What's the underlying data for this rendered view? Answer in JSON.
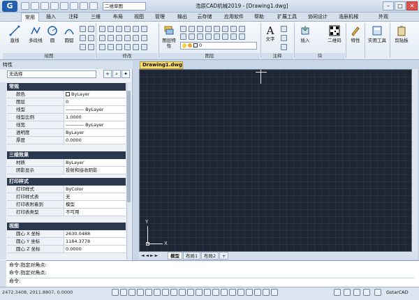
{
  "app": {
    "logo": "G",
    "title": "浩辰CAD机械2019 - [Drawing1.dwg]",
    "workspace": "二维草图"
  },
  "tabs": [
    "常用",
    "插入",
    "注释",
    "三维",
    "布局",
    "视图",
    "管理",
    "输出",
    "云存储",
    "应用软件",
    "帮助",
    "扩展工具",
    "协同设计",
    "浩辰机械",
    "外观"
  ],
  "ribbon": {
    "draw": {
      "buttons": [
        "直线",
        "多段线",
        "圆",
        "圆弧"
      ],
      "label": "绘图"
    },
    "modify": {
      "label": "修改"
    },
    "layer": {
      "props_label": "图层特性",
      "current": "0",
      "label": "图层"
    },
    "annotate": {
      "text": "文字",
      "label": "注释"
    },
    "block": {
      "insert": "插入",
      "qr": "二维码",
      "label": "块"
    },
    "properties": "特性",
    "utilities": "实用工具",
    "clipboard": "剪贴板"
  },
  "properties_panel": {
    "title": "特性",
    "selection": "无选择",
    "sections": [
      {
        "name": "常规",
        "rows": [
          [
            "颜色",
            "ByLayer"
          ],
          [
            "图层",
            "0"
          ],
          [
            "线型",
            "———— ByLayer"
          ],
          [
            "线型比例",
            "1.0000"
          ],
          [
            "线宽",
            "———— ByLayer"
          ],
          [
            "透明度",
            "ByLayer"
          ],
          [
            "厚度",
            "0.0000"
          ]
        ]
      },
      {
        "name": "三维效果",
        "rows": [
          [
            "材质",
            "ByLayer"
          ],
          [
            "阴影显示",
            "投射和接收阴影"
          ]
        ]
      },
      {
        "name": "打印样式",
        "rows": [
          [
            "打印样式",
            "ByColor"
          ],
          [
            "打印样式表",
            "无"
          ],
          [
            "打印表附着到",
            "模型"
          ],
          [
            "打印表类型",
            "不可用"
          ]
        ]
      },
      {
        "name": "视图",
        "rows": [
          [
            "圆心 X 坐标",
            "2630.0488"
          ],
          [
            "圆心 Y 坐标",
            "1184.3778"
          ],
          [
            "圆心 Z 坐标",
            "0.0000"
          ]
        ]
      }
    ]
  },
  "drawing": {
    "tab": "Drawing1.dwg",
    "layout_tabs": [
      "模型",
      "布局1",
      "布局2"
    ],
    "ucs_x": "X",
    "ucs_y": "Y"
  },
  "command": {
    "lines": [
      "命令:指定对角点:",
      "命令:指定对角点:",
      "命令:"
    ]
  },
  "status": {
    "coords": "2472.3408, 2011.8807, 0.0000",
    "brand": "GstarCAD"
  }
}
